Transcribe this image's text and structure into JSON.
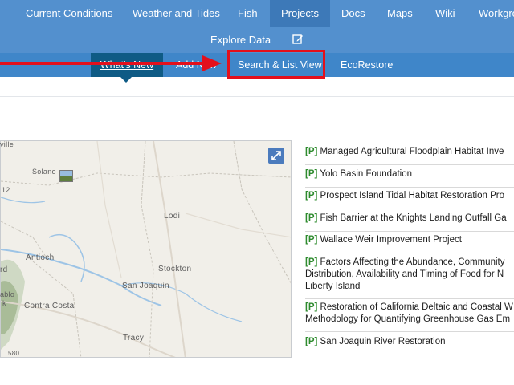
{
  "nav": {
    "items": [
      "Current Conditions",
      "Weather and Tides",
      "Fish",
      "Projects",
      "Docs",
      "Maps",
      "Wiki",
      "Workgro"
    ],
    "active": "Projects",
    "explore": "Explore Data"
  },
  "subnav": {
    "tabs": [
      "What's New",
      "Add New",
      "Search & List View",
      "EcoRestore"
    ]
  },
  "map": {
    "labels": [
      "ville",
      "Solano",
      "12",
      "Lodi",
      "Antioch",
      "rd",
      "Stockton",
      "San Joaquin",
      "Contra Costa",
      "ablo",
      "k",
      "Tracy",
      "580"
    ]
  },
  "projects": [
    {
      "tag": "[P]",
      "lines": [
        "Managed Agricultural Floodplain Habitat Inve"
      ]
    },
    {
      "tag": "[P]",
      "lines": [
        "Yolo Basin Foundation"
      ]
    },
    {
      "tag": "[P]",
      "lines": [
        "Prospect Island Tidal Habitat Restoration Pro"
      ]
    },
    {
      "tag": "[P]",
      "lines": [
        "Fish Barrier at the Knights Landing Outfall Ga"
      ]
    },
    {
      "tag": "[P]",
      "lines": [
        "Wallace Weir Improvement Project"
      ]
    },
    {
      "tag": "[P]",
      "lines": [
        "Factors Affecting the Abundance, Community",
        "Distribution, Availability and Timing of Food for N",
        "Liberty Island"
      ]
    },
    {
      "tag": "[P]",
      "lines": [
        "Restoration of California Deltaic and Coastal W",
        "Methodology for Quantifying Greenhouse Gas Em"
      ]
    },
    {
      "tag": "[P]",
      "lines": [
        "San Joaquin River Restoration"
      ]
    }
  ],
  "colors": {
    "nav": "#5390ce",
    "subnav": "#3f86c9",
    "active_tab": "#0f5b85",
    "highlight": "#e3101c",
    "tag": "#2e8b2e"
  }
}
